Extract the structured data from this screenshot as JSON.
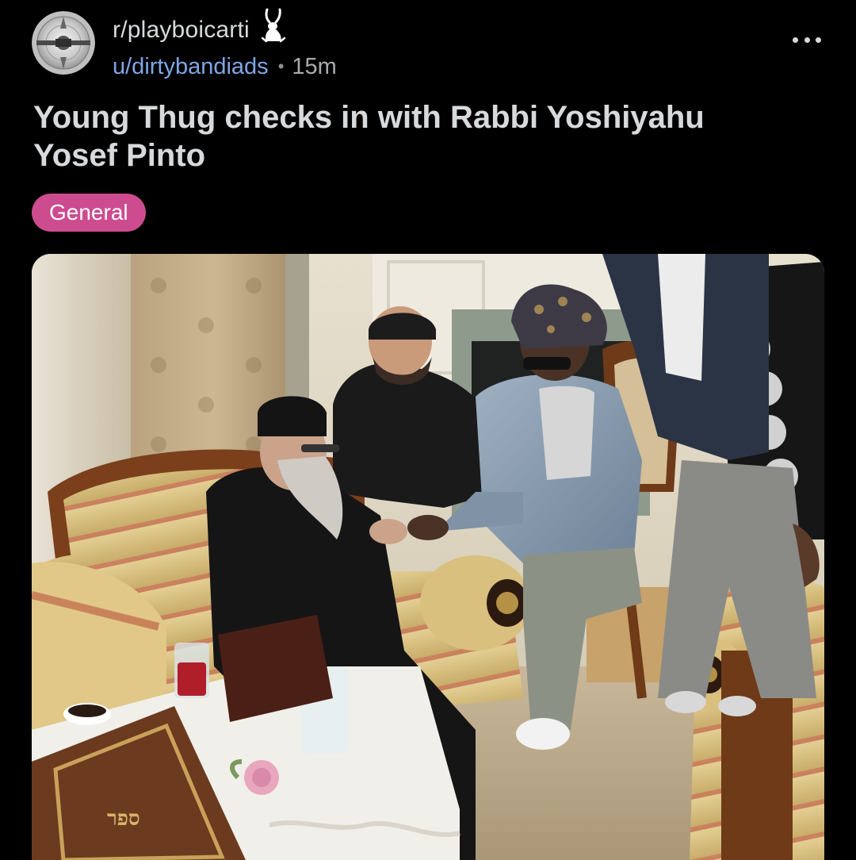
{
  "post": {
    "subreddit": "r/playboicarti",
    "username": "u/dirtybandiads",
    "separator": "•",
    "timestamp": "15m",
    "title": "Young Thug checks in with Rabbi Yoshiyahu Yosef Pinto",
    "flair": "General",
    "flair_color": "#cc4c8f",
    "username_color": "#7fa6e6",
    "book_cover_text": "ספר"
  },
  "icons": {
    "avatar": "subreddit-avatar-disc-icon",
    "user_flair": "bunny-icon",
    "overflow": "more-options-icon"
  }
}
